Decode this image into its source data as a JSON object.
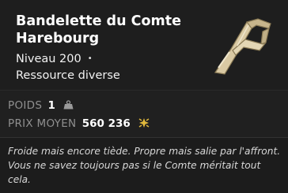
{
  "item": {
    "name": "Bandelette du Comte Harebourg",
    "level": "Niveau 200",
    "level_bullet": "•",
    "type": "Ressource diverse",
    "icon": "bandage-strip-item-icon"
  },
  "stats": {
    "weight_label": "POIDS",
    "weight_value": "1",
    "weight_icon": "weight-icon",
    "price_label": "PRIX MOYEN",
    "price_value": "560 236",
    "price_icon": "kamas-coin-icon"
  },
  "description": "Froide mais encore tiède. Propre mais salie par l'affront. Vous ne savez toujours pas si le Comte méritait tout cela.",
  "colors": {
    "background": "#1c1c1c",
    "title": "#ffffff",
    "label": "#8f8f8f",
    "coin": "#e0b83c"
  }
}
